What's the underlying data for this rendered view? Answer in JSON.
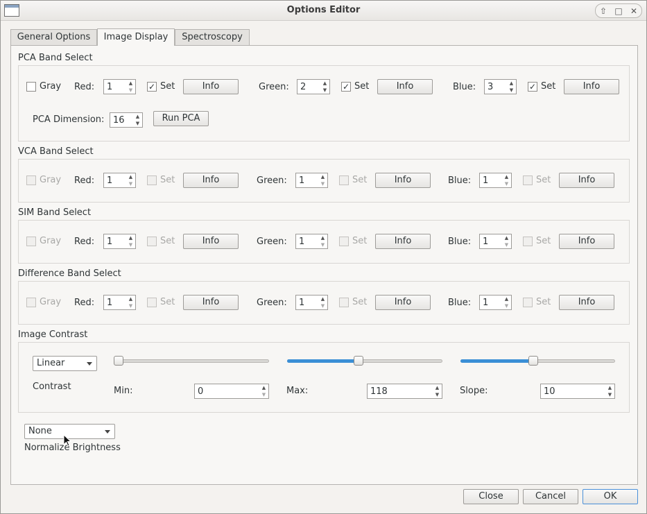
{
  "window": {
    "title": "Options Editor"
  },
  "tabs": [
    {
      "label": "General Options"
    },
    {
      "label": "Image Display"
    },
    {
      "label": "Spectroscopy"
    }
  ],
  "pca": {
    "title": "PCA Band Select",
    "gray_label": "Gray",
    "gray_checked": false,
    "red_label": "Red:",
    "red_value": "1",
    "green_label": "Green:",
    "green_value": "2",
    "blue_label": "Blue:",
    "blue_value": "3",
    "set_label": "Set",
    "info_label": "Info",
    "dimension_label": "PCA Dimension:",
    "dimension_value": "16",
    "run_label": "Run PCA"
  },
  "vca": {
    "title": "VCA Band Select",
    "gray_label": "Gray",
    "red_label": "Red:",
    "red_value": "1",
    "green_label": "Green:",
    "green_value": "1",
    "blue_label": "Blue:",
    "blue_value": "1",
    "set_label": "Set",
    "info_label": "Info"
  },
  "sim": {
    "title": "SIM Band Select",
    "gray_label": "Gray",
    "red_label": "Red:",
    "red_value": "1",
    "green_label": "Green:",
    "green_value": "1",
    "blue_label": "Blue:",
    "blue_value": "1",
    "set_label": "Set",
    "info_label": "Info"
  },
  "diff": {
    "title": "Difference Band Select",
    "gray_label": "Gray",
    "red_label": "Red:",
    "red_value": "1",
    "green_label": "Green:",
    "green_value": "1",
    "blue_label": "Blue:",
    "blue_value": "1",
    "set_label": "Set",
    "info_label": "Info"
  },
  "contrast": {
    "title": "Image Contrast",
    "mode": "Linear",
    "mode_caption": "Contrast",
    "min_label": "Min:",
    "min_value": "0",
    "max_label": "Max:",
    "max_value": "118",
    "slope_label": "Slope:",
    "slope_value": "10",
    "min_slider_fraction": 0.0,
    "max_slider_fraction": 0.46,
    "slope_slider_fraction": 0.47,
    "accent_color": "#3b8fd6"
  },
  "normalize": {
    "value": "None",
    "caption": "Normalize Brightness"
  },
  "footer": {
    "close_label": "Close",
    "cancel_label": "Cancel",
    "ok_label": "OK"
  }
}
